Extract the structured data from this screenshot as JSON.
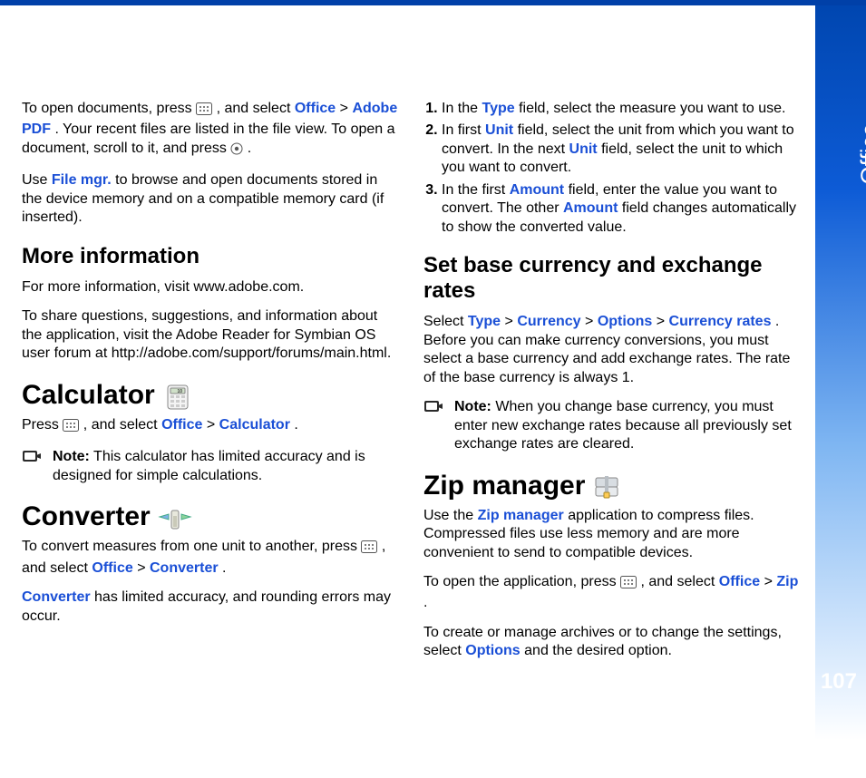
{
  "sidebar": {
    "label": "Office",
    "page": "107"
  },
  "left": {
    "p1a": "To open documents, press ",
    "p1b": " , and select ",
    "kw_office": "Office",
    "gt": " > ",
    "kw_adobe_pdf": "Adobe PDF",
    "p1c": ". Your recent files are listed in the file view. To open a document, scroll to it, and press ",
    "p1d": " .",
    "p2a": "Use ",
    "kw_filemgr": "File mgr.",
    "p2b": " to browse and open documents stored in the device memory and on  a compatible memory card (if inserted).",
    "h_moreinfo": "More information",
    "p3": "For more information, visit www.adobe.com.",
    "p4": "To share questions, suggestions, and information about the application, visit the Adobe Reader for Symbian OS user forum at http://adobe.com/support/forums/main.html.",
    "h_calc": "Calculator",
    "p5a": "Press ",
    "p5b": " , and select ",
    "kw_calc": "Calculator",
    "p5c": ".",
    "note1_label": "Note:",
    "note1_body": " This calculator has limited accuracy and is designed for simple calculations.",
    "h_conv": "Converter",
    "p6a": "To convert measures from one unit to another, press ",
    "p6b": " , and select ",
    "kw_conv": "Converter",
    "p6c": ".",
    "p7a_kw": "Converter",
    "p7b": " has limited accuracy, and rounding errors may occur."
  },
  "right": {
    "steps": [
      {
        "a": "In the ",
        "kw1": "Type",
        "b": " field, select the measure you want to use."
      },
      {
        "a": "In first ",
        "kw1": "Unit",
        "b": " field, select the unit from which you want to convert. In the next ",
        "kw2": "Unit",
        "c": " field, select the unit to which you want to convert."
      },
      {
        "a": "In the first ",
        "kw1": "Amount",
        "b": " field, enter the value you want to convert. The other ",
        "kw2": "Amount",
        "c": " field changes automatically to show the converted value."
      }
    ],
    "h_base": "Set base currency and exchange rates",
    "p_base_a": "Select ",
    "kw_type": "Type",
    "kw_currency": "Currency",
    "kw_options": "Options",
    "kw_crates": "Currency rates",
    "p_base_b": ". Before you can make currency conversions, you must select a base currency and add exchange rates. The rate of the base currency is always 1.",
    "note2_label": "Note:",
    "note2_body": " When you change base currency, you must enter new exchange rates because all previously set exchange rates are cleared.",
    "h_zip": "Zip manager",
    "p_zip1a": "Use the ",
    "kw_zipmgr": "Zip manager",
    "p_zip1b": " application to compress files. Compressed files use less memory and are more convenient to send to compatible devices.",
    "p_zip2a": "To open the application, press ",
    "p_zip2b": " , and select ",
    "kw_office2": "Office",
    "kw_zip": "Zip",
    "p_zip2c": ".",
    "p_zip3a": "To create or manage archives or to change the settings, select ",
    "kw_options2": "Options",
    "p_zip3b": " and the desired option."
  }
}
